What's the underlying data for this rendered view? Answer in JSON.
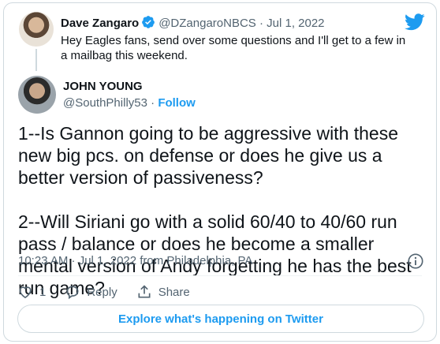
{
  "quoted": {
    "name": "Dave Zangaro",
    "handle": "@DZangaroNBCS · Jul 1, 2022",
    "text": "Hey Eagles fans, send over some questions and I'll get to a few in a mailbag this weekend."
  },
  "tweet": {
    "name": "JOHN YOUNG",
    "handle": "@SouthPhilly53",
    "dot": " · ",
    "follow": "Follow",
    "paragraphs": [
      "1--Is Gannon going to be aggressive with these new big pcs. on defense or does he give us a better version of passiveness?",
      "2--Will Siriani go with a solid 60/40 to 40/60 run pass / balance or does he become a smaller mental version of Andy forgetting he has the best run game?"
    ],
    "meta": "10:23 AM · Jul 1, 2022 from Philadelphia, PA",
    "like_count": "1",
    "reply_label": "Reply",
    "share_label": "Share"
  },
  "explore_label": "Explore what's happening on Twitter",
  "colors": {
    "brand": "#1d9bf0",
    "text": "#0f1419",
    "muted": "#536471",
    "border": "#cfd9de"
  },
  "icons": [
    "verified-badge-icon",
    "twitter-bird-icon",
    "info-icon",
    "heart-icon",
    "reply-icon",
    "share-icon"
  ]
}
